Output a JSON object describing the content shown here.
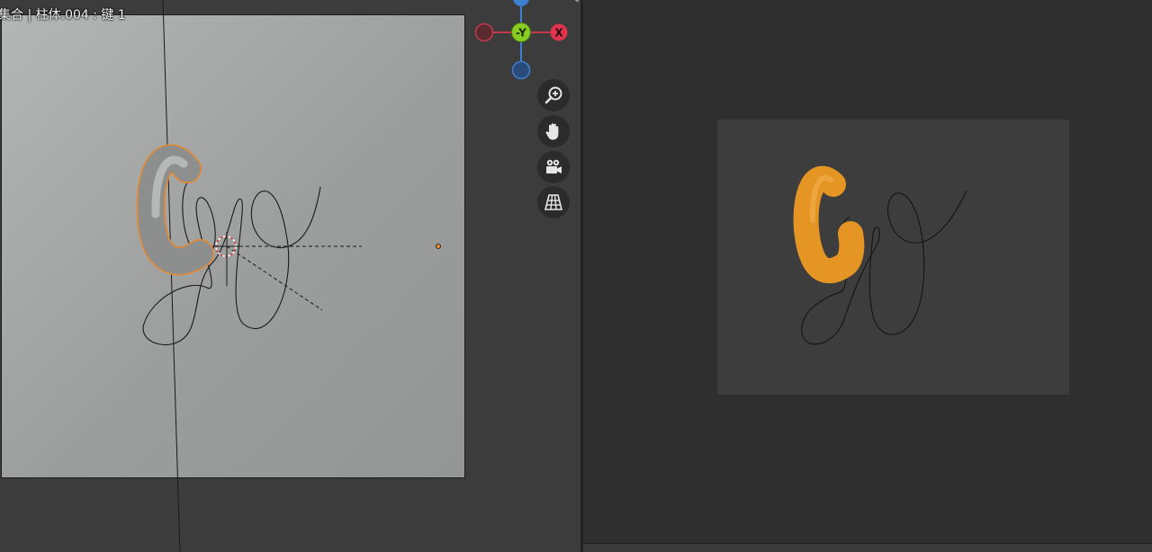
{
  "left_viewport": {
    "title": "集合 | 柱体.004 : 键 1"
  },
  "gizmo": {
    "neg_y_label": "-Y",
    "x_label": "X",
    "colors": {
      "x": "#e0344c",
      "x_neg": "#9b3040",
      "y": "#88cc22",
      "z": "#3d7fd1",
      "axis_line_x": "#c43a4c",
      "axis_line_z": "#3d7fd1"
    }
  },
  "nav_tools": [
    {
      "name": "zoom",
      "icon": "zoom-in-icon"
    },
    {
      "name": "pan",
      "icon": "hand-icon"
    },
    {
      "name": "camera",
      "icon": "camera-icon"
    },
    {
      "name": "perspective",
      "icon": "grid-perspective-icon"
    }
  ],
  "colors": {
    "selection_outline": "#e8892a",
    "render_object": "#e59524",
    "curve_stroke": "#1a1a1a"
  }
}
